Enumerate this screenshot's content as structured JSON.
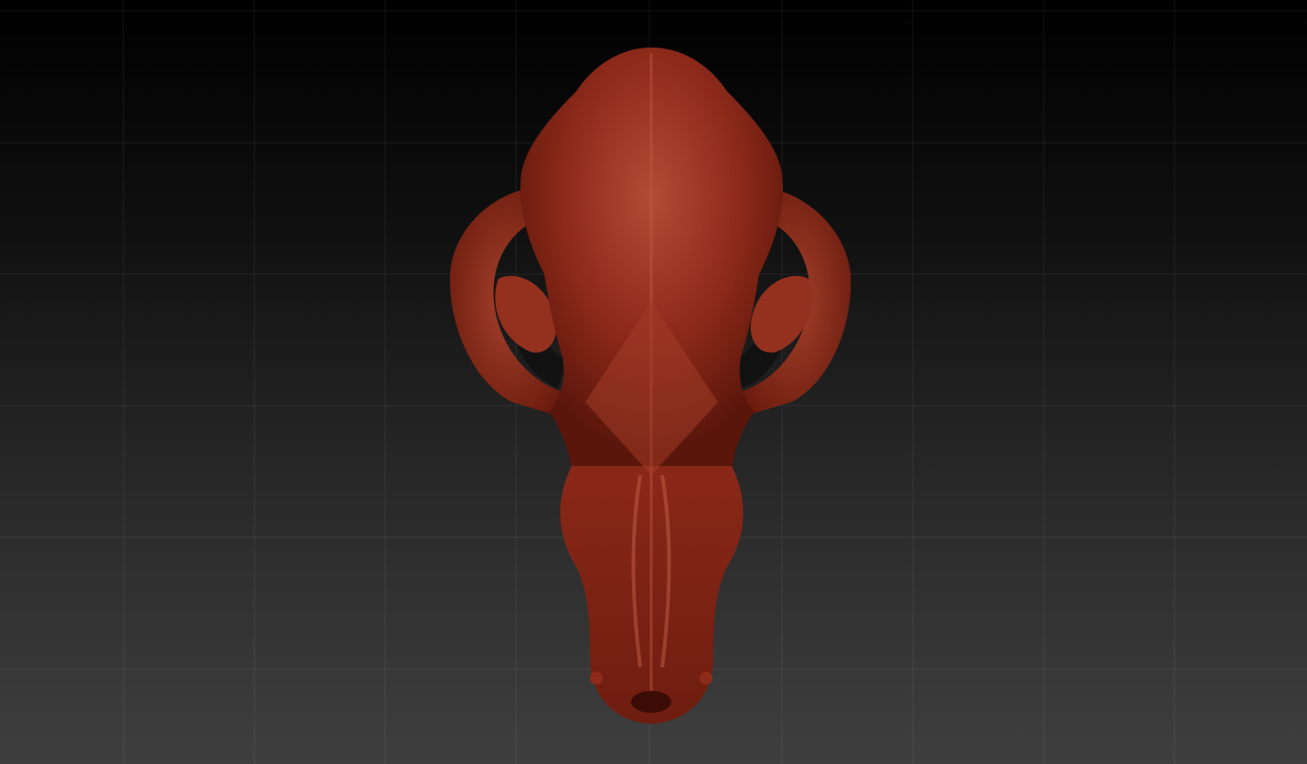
{
  "viewport": {
    "background_top": "#000000",
    "background_bottom": "#3f3f3f",
    "grid_color": "#3a3a3a"
  },
  "model": {
    "subject": "skull-model",
    "material_color": "#8e2a1a",
    "highlight_color": "#b5503a",
    "shadow_color": "#4a1208"
  }
}
